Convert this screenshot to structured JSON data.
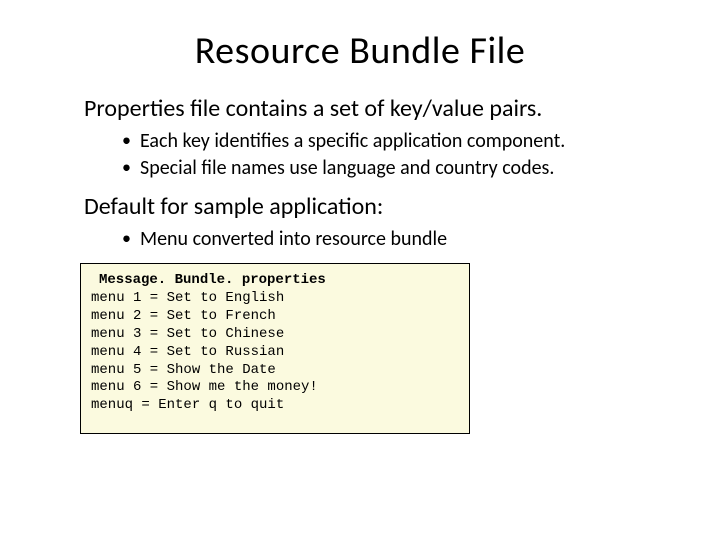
{
  "title": "Resource Bundle File",
  "section1": {
    "heading": "Properties file contains a set of key/value pairs.",
    "bullets": [
      "Each key identifies a specific application component.",
      "Special file names use language and country codes."
    ]
  },
  "section2": {
    "heading": "Default for sample application:",
    "bullets": [
      "Menu converted into resource bundle"
    ]
  },
  "code": {
    "header": "Message. Bundle. properties",
    "lines": [
      "menu 1 = Set to English",
      "menu 2 = Set to French",
      "menu 3 = Set to Chinese",
      "menu 4 = Set to Russian",
      "menu 5 = Show the Date",
      "menu 6 = Show me the money!",
      "menuq = Enter q to quit"
    ]
  }
}
